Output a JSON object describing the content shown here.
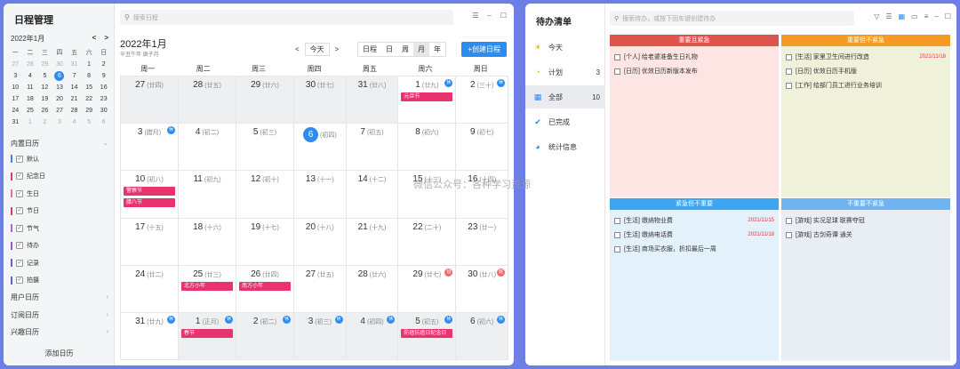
{
  "calendar_app": {
    "sidebar": {
      "title": "日程管理",
      "mini_month": "2022年1月",
      "mini_prev": "<",
      "mini_next": ">",
      "mini_weekdays": [
        "一",
        "二",
        "三",
        "四",
        "五",
        "六",
        "日"
      ],
      "mini_days": [
        {
          "d": "27",
          "om": true
        },
        {
          "d": "28",
          "om": true
        },
        {
          "d": "29",
          "om": true
        },
        {
          "d": "30",
          "om": true
        },
        {
          "d": "31",
          "om": true
        },
        {
          "d": "1"
        },
        {
          "d": "2"
        },
        {
          "d": "3"
        },
        {
          "d": "4"
        },
        {
          "d": "5"
        },
        {
          "d": "6",
          "today": true
        },
        {
          "d": "7"
        },
        {
          "d": "8"
        },
        {
          "d": "9"
        },
        {
          "d": "10"
        },
        {
          "d": "11"
        },
        {
          "d": "12"
        },
        {
          "d": "13"
        },
        {
          "d": "14"
        },
        {
          "d": "15"
        },
        {
          "d": "16"
        },
        {
          "d": "17"
        },
        {
          "d": "18"
        },
        {
          "d": "19"
        },
        {
          "d": "20"
        },
        {
          "d": "21"
        },
        {
          "d": "22"
        },
        {
          "d": "23"
        },
        {
          "d": "24"
        },
        {
          "d": "25"
        },
        {
          "d": "26"
        },
        {
          "d": "27"
        },
        {
          "d": "28"
        },
        {
          "d": "29"
        },
        {
          "d": "30"
        },
        {
          "d": "31"
        },
        {
          "d": "1",
          "om": true
        },
        {
          "d": "2",
          "om": true
        },
        {
          "d": "3",
          "om": true
        },
        {
          "d": "4",
          "om": true
        },
        {
          "d": "5",
          "om": true
        },
        {
          "d": "6",
          "om": true
        }
      ],
      "section_builtin": "内置日历",
      "calendars": [
        {
          "label": "默认",
          "color": "#2d8cf0"
        },
        {
          "label": "纪念日",
          "color": "#e8336f"
        },
        {
          "label": "生日",
          "color": "#f06aa0"
        },
        {
          "label": "节日",
          "color": "#e8336f"
        },
        {
          "label": "节气",
          "color": "#aa66dd"
        },
        {
          "label": "待办",
          "color": "#9955cc"
        },
        {
          "label": "记录",
          "color": "#6a5be0"
        },
        {
          "label": "拍摄",
          "color": "#5566dd"
        }
      ],
      "section_user": "用户日历",
      "section_sub": "订阅日历",
      "section_interest": "兴趣日历",
      "add_calendar": "添加日历"
    },
    "search_placeholder": "搜索日程",
    "month_title": "2022年1月",
    "lunar_text": "辛丑牛年 庚子月",
    "nav_prev": "<",
    "nav_today": "今天",
    "nav_next": ">",
    "views": [
      "日程",
      "日",
      "周",
      "月",
      "年"
    ],
    "active_view": "月",
    "create_button": "+创建日程",
    "weekdays": [
      "周一",
      "周二",
      "周三",
      "周四",
      "周五",
      "周六",
      "周日"
    ],
    "days": [
      {
        "d": "27",
        "l": "(廿四)",
        "om": true
      },
      {
        "d": "28",
        "l": "(廿五)",
        "om": true
      },
      {
        "d": "29",
        "l": "(廿六)",
        "om": true
      },
      {
        "d": "30",
        "l": "(廿七)",
        "om": true
      },
      {
        "d": "31",
        "l": "(廿八)",
        "om": true
      },
      {
        "d": "1",
        "l": "(廿九)",
        "badge": "休",
        "ev": [
          "元旦节"
        ]
      },
      {
        "d": "2",
        "l": "(三十)",
        "badge": "休"
      },
      {
        "d": "3",
        "l": "(腊月)",
        "badge": "休"
      },
      {
        "d": "4",
        "l": "(初二)"
      },
      {
        "d": "5",
        "l": "(初三)"
      },
      {
        "d": "6",
        "l": "(初四)",
        "today": true
      },
      {
        "d": "7",
        "l": "(初五)"
      },
      {
        "d": "8",
        "l": "(初六)"
      },
      {
        "d": "9",
        "l": "(初七)"
      },
      {
        "d": "10",
        "l": "(初八)",
        "ev": [
          "警察节",
          "腊八节"
        ]
      },
      {
        "d": "11",
        "l": "(初九)"
      },
      {
        "d": "12",
        "l": "(初十)"
      },
      {
        "d": "13",
        "l": "(十一)"
      },
      {
        "d": "14",
        "l": "(十二)"
      },
      {
        "d": "15",
        "l": "(十三)"
      },
      {
        "d": "16",
        "l": "(十四)"
      },
      {
        "d": "17",
        "l": "(十五)"
      },
      {
        "d": "18",
        "l": "(十六)"
      },
      {
        "d": "19",
        "l": "(十七)"
      },
      {
        "d": "20",
        "l": "(十八)"
      },
      {
        "d": "21",
        "l": "(十九)"
      },
      {
        "d": "22",
        "l": "(二十)"
      },
      {
        "d": "23",
        "l": "(廿一)"
      },
      {
        "d": "24",
        "l": "(廿二)"
      },
      {
        "d": "25",
        "l": "(廿三)",
        "ev": [
          "北方小年"
        ]
      },
      {
        "d": "26",
        "l": "(廿四)",
        "ev": [
          "南方小年"
        ]
      },
      {
        "d": "27",
        "l": "(廿五)"
      },
      {
        "d": "28",
        "l": "(廿六)"
      },
      {
        "d": "29",
        "l": "(廿七)",
        "badge": "班",
        "work": true
      },
      {
        "d": "30",
        "l": "(廿八)",
        "badge": "班",
        "work": true
      },
      {
        "d": "31",
        "l": "(廿九)",
        "badge": "休"
      },
      {
        "d": "1",
        "l": "(正月)",
        "badge": "休",
        "om": true,
        "ev": [
          "春节"
        ]
      },
      {
        "d": "2",
        "l": "(初二)",
        "badge": "休",
        "om": true
      },
      {
        "d": "3",
        "l": "(初三)",
        "badge": "休",
        "om": true
      },
      {
        "d": "4",
        "l": "(初四)",
        "badge": "休",
        "om": true
      },
      {
        "d": "5",
        "l": "(初五)",
        "badge": "休",
        "om": true,
        "ev": [
          "防癌抗癌日纪念日"
        ]
      },
      {
        "d": "6",
        "l": "(初六)",
        "badge": "休",
        "om": true
      }
    ],
    "watermark": "微信公众号：各种学习资源"
  },
  "todo_app": {
    "title": "待办清单",
    "nav": [
      {
        "label": "今天",
        "icon": "☀",
        "color": "#f5a623",
        "count": ""
      },
      {
        "label": "计划",
        "icon": "◔",
        "color": "#f5a623",
        "count": "3"
      },
      {
        "label": "全部",
        "icon": "▦",
        "color": "#2d8cf0",
        "count": "10",
        "active": true
      },
      {
        "label": "已完成",
        "icon": "✔",
        "color": "#2d8cf0",
        "count": ""
      },
      {
        "label": "统计信息",
        "icon": "◕",
        "color": "#2d8cf0",
        "count": ""
      }
    ],
    "search_placeholder": "搜索待办，或按下回车键创建待办",
    "quadrants": [
      {
        "title": "重要且紧急",
        "color": "#e0544e",
        "bg": "#fde5e3",
        "items": [
          {
            "text": "[个人] 给老婆准备生日礼物",
            "date": ""
          },
          {
            "text": "[日历] 优效日历新版本发布",
            "date": ""
          }
        ]
      },
      {
        "title": "重要但不紧急",
        "color": "#f59b25",
        "bg": "#f0f1db",
        "items": [
          {
            "text": "[生活] 家里卫生间进行改造",
            "date": "2021/11/18"
          },
          {
            "text": "[日历] 优效日历手机版",
            "date": ""
          },
          {
            "text": "[工作] 给部门员工进行业务培训",
            "date": ""
          }
        ]
      },
      {
        "title": "紧急但不重要",
        "color": "#3ea6f0",
        "bg": "#e3f1fb",
        "items": [
          {
            "text": "[生活] 缴纳物业费",
            "date": "2021/11/15"
          },
          {
            "text": "[生活] 缴纳电话费",
            "date": "2021/11/18"
          },
          {
            "text": "[生活] 商场买衣服，折扣最后一周",
            "date": ""
          }
        ]
      },
      {
        "title": "不重要不紧急",
        "color": "#6fb3f0",
        "bg": "#e8eef3",
        "items": [
          {
            "text": "[游戏] 实况足球 联赛夺冠",
            "date": ""
          },
          {
            "text": "[游戏] 古剑奇谭 通关",
            "date": ""
          }
        ]
      }
    ]
  }
}
